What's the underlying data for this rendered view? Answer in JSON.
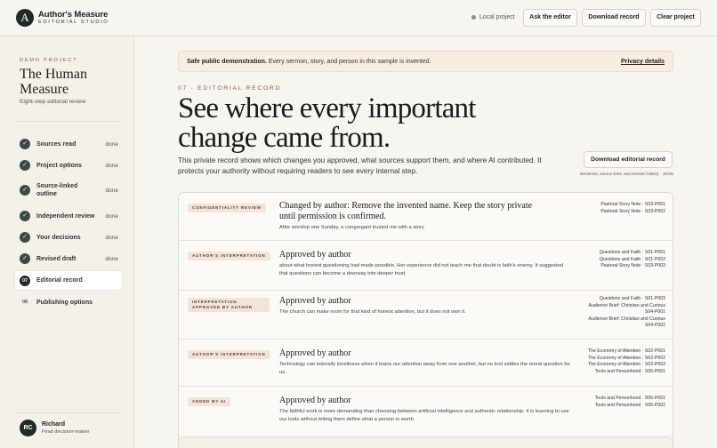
{
  "header": {
    "logo_letter": "A",
    "brand_name": "Author's Measure",
    "brand_sub": "EDITORIAL STUDIO",
    "local_status": "Local project",
    "buttons": {
      "ask": "Ask the editor",
      "download": "Download record",
      "clear": "Clear project"
    }
  },
  "sidebar": {
    "demo_label": "DEMO PROJECT",
    "project_title": "The Human Measure",
    "project_sub": "Eight-step editorial review",
    "steps": [
      {
        "label": "Sources read",
        "status": "done",
        "icon": "check-icon"
      },
      {
        "label": "Project options",
        "status": "done",
        "icon": "check-icon"
      },
      {
        "label": "Source-linked outline",
        "status": "done",
        "icon": "check-icon"
      },
      {
        "label": "Independent review",
        "status": "done",
        "icon": "check-icon"
      },
      {
        "label": "Your decisions",
        "status": "done",
        "icon": "check-icon"
      },
      {
        "label": "Revised draft",
        "status": "done",
        "icon": "check-icon"
      },
      {
        "label": "Editorial record",
        "number": "07",
        "active": true
      },
      {
        "label": "Publishing options",
        "number": "08"
      }
    ],
    "user": {
      "initials": "RC",
      "name": "Richard",
      "role": "Final decision-maker"
    }
  },
  "main": {
    "notice_bold": "Safe public demonstration.",
    "notice_text": "Every sermon, story, and person in this sample is invented.",
    "notice_link": "Privacy details",
    "eyebrow": "07 · EDITORIAL RECORD",
    "headline": "See where every important change came from.",
    "lede": "This private record shows which changes you approved, what sources support them, and where AI contributed. It protects your authority without requiring readers to see every internal step.",
    "download_button": "Download editorial record",
    "download_note": "Decisions, source links, and revision history · JSON",
    "rows": [
      {
        "tag": "CONFIDENTIALITY REVIEW",
        "title": "Changed by author: Remove the invented name. Keep the story private until permission is confirmed.",
        "desc": "After worship one Sunday, a congregant trusted me with a story",
        "refs": [
          "Pastoral Story Note · S03-P001",
          "Pastoral Story Note · S03-P002"
        ]
      },
      {
        "tag": "AUTHOR'S INTERPRETATION",
        "title": "Approved by author",
        "desc": "about what honest questioning had made possible. Her experience did not teach me that doubt is faith's enemy. It suggested that questions can become a doorway into deeper trust.",
        "refs": [
          "Questions and Faith · S01-P001",
          "Questions and Faith · S01-P002",
          "Pastoral Story Note · S03-P003"
        ]
      },
      {
        "tag": "INTERPRETATION APPROVED BY AUTHOR",
        "title": "Approved by author",
        "desc": "The church can make room for that kind of honest attention, but it does not own it.",
        "refs": [
          "Questions and Faith · S01-P003",
          "Audience Brief: Christian and Curious",
          "S04-P001",
          "Audience Brief: Christian and Curious",
          "S04-P002"
        ]
      },
      {
        "tag": "AUTHOR'S INTERPRETATION",
        "title": "Approved by author",
        "desc": "Technology can intensify loneliness when it trains our attention away from one another, but no tool settles the moral question for us.",
        "refs": [
          "The Economy of Attention · S02-P001",
          "The Economy of Attention · S02-P002",
          "The Economy of Attention · S02-P003",
          "Tools and Personhood · S05-P001"
        ]
      },
      {
        "tag": "ADDED BY AI",
        "title": "Approved by author",
        "desc": "The faithful work is more demanding than choosing between artificial intelligence and authentic relationship: it is learning to use our tools without letting them define what a person is worth.",
        "refs": [
          "Tools and Personhood · S05-P001",
          "Tools and Personhood · S05-P002"
        ]
      }
    ]
  }
}
